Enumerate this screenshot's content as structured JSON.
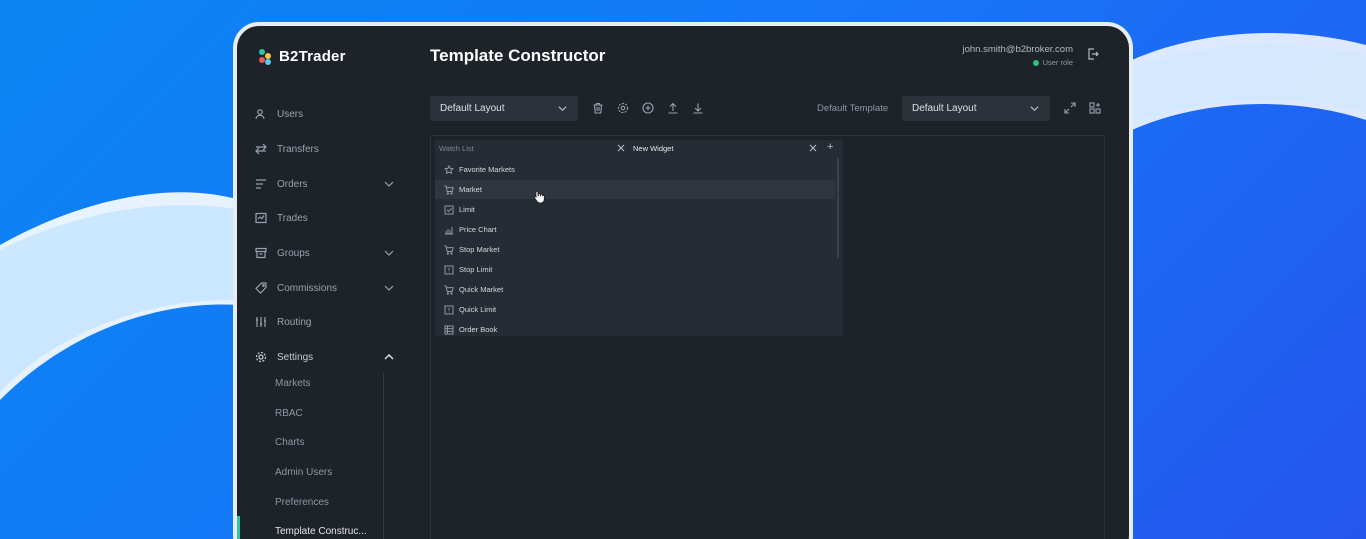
{
  "brand": {
    "name": "B2Trader"
  },
  "header": {
    "title": "Template Constructor",
    "user_email": "john.smith@b2broker.com",
    "user_role": "User role"
  },
  "sidebar": {
    "items": [
      {
        "label": "Users",
        "icon": "users-icon"
      },
      {
        "label": "Transfers",
        "icon": "transfer-icon"
      },
      {
        "label": "Orders",
        "icon": "orders-icon"
      },
      {
        "label": "Trades",
        "icon": "trades-icon"
      },
      {
        "label": "Groups",
        "icon": "groups-icon"
      },
      {
        "label": "Commissions",
        "icon": "tag-icon"
      },
      {
        "label": "Routing",
        "icon": "sliders-icon"
      },
      {
        "label": "Settings",
        "icon": "gear-icon"
      }
    ],
    "settings_sub": [
      "Markets",
      "RBAC",
      "Charts",
      "Admin Users",
      "Preferences",
      "Template Construc..."
    ]
  },
  "toolbar": {
    "layout_select": "Default Layout",
    "template_label": "Default Template",
    "template_select": "Default Layout",
    "icons": [
      "trash-icon",
      "gear-icon",
      "plus-circle-icon",
      "upload-icon",
      "download-icon"
    ]
  },
  "widget": {
    "tabs": [
      {
        "label": "Watch List",
        "active": false
      },
      {
        "label": "New Widget",
        "active": true
      }
    ],
    "menu": [
      {
        "label": "Favorite Markets",
        "icon": "star-icon"
      },
      {
        "label": "Market",
        "icon": "cart-icon"
      },
      {
        "label": "Limit",
        "icon": "checkbox-icon"
      },
      {
        "label": "Price Chart",
        "icon": "chart-icon"
      },
      {
        "label": "Stop Market",
        "icon": "cart-icon"
      },
      {
        "label": "Stop Limit",
        "icon": "alert-box-icon"
      },
      {
        "label": "Quick Market",
        "icon": "cart-icon"
      },
      {
        "label": "Quick Limit",
        "icon": "alert-box-icon"
      },
      {
        "label": "Order Book",
        "icon": "table-icon"
      }
    ],
    "hovered_item": "Market"
  },
  "colors": {
    "background": "#1677f7",
    "panel": "#1e2329",
    "accent": "#2ec4a6",
    "online": "#2ec47a"
  }
}
